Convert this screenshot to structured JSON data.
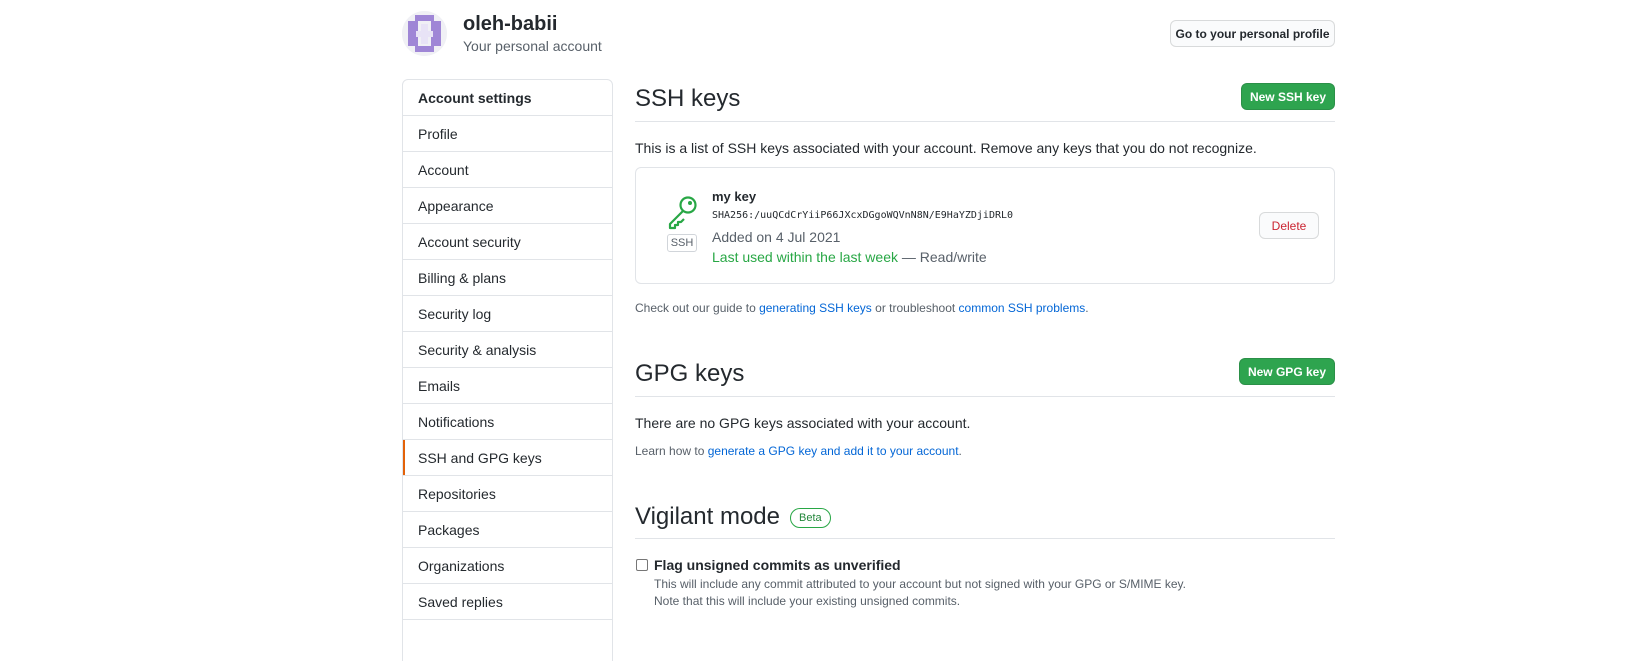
{
  "header": {
    "username": "oleh-babii",
    "subtitle": "Your personal account",
    "profile_button": "Go to your personal profile"
  },
  "sidebar": {
    "items": [
      {
        "label": "Account settings"
      },
      {
        "label": "Profile"
      },
      {
        "label": "Account"
      },
      {
        "label": "Appearance"
      },
      {
        "label": "Account security"
      },
      {
        "label": "Billing & plans"
      },
      {
        "label": "Security log"
      },
      {
        "label": "Security & analysis"
      },
      {
        "label": "Emails"
      },
      {
        "label": "Notifications"
      },
      {
        "label": "SSH and GPG keys"
      },
      {
        "label": "Repositories"
      },
      {
        "label": "Packages"
      },
      {
        "label": "Organizations"
      },
      {
        "label": "Saved replies"
      }
    ]
  },
  "ssh": {
    "title": "SSH keys",
    "new_button": "New SSH key",
    "description": "This is a list of SSH keys associated with your account. Remove any keys that you do not recognize.",
    "key": {
      "badge": "SSH",
      "name": "my key",
      "fingerprint": "SHA256:/uuQCdCrYiiP66JXcxDGgoWQVnN8N/E9HaYZDjiDRL0",
      "added": "Added on 4 Jul 2021",
      "last_used": "Last used within the last week",
      "access": " — Read/write",
      "delete_button": "Delete"
    },
    "guide": {
      "prefix": "Check out our guide to ",
      "link1": "generating SSH keys",
      "middle": " or troubleshoot ",
      "link2": "common SSH problems",
      "suffix": "."
    }
  },
  "gpg": {
    "title": "GPG keys",
    "new_button": "New GPG key",
    "empty": "There are no GPG keys associated with your account.",
    "learn": {
      "prefix": "Learn how to ",
      "link": "generate a GPG key and add it to your account",
      "suffix": "."
    }
  },
  "vigilant": {
    "title": "Vigilant mode",
    "badge": "Beta",
    "checkbox_label": "Flag unsigned commits as unverified",
    "checked": false,
    "help1": "This will include any commit attributed to your account but not signed with your GPG or S/MIME key.",
    "help2": "Note that this will include your existing unsigned commits."
  },
  "colors": {
    "primary_button": "#2ea44f",
    "link": "#0366d6",
    "danger": "#cb2431",
    "selected_indicator": "#e36209",
    "success_text": "#28a745"
  }
}
